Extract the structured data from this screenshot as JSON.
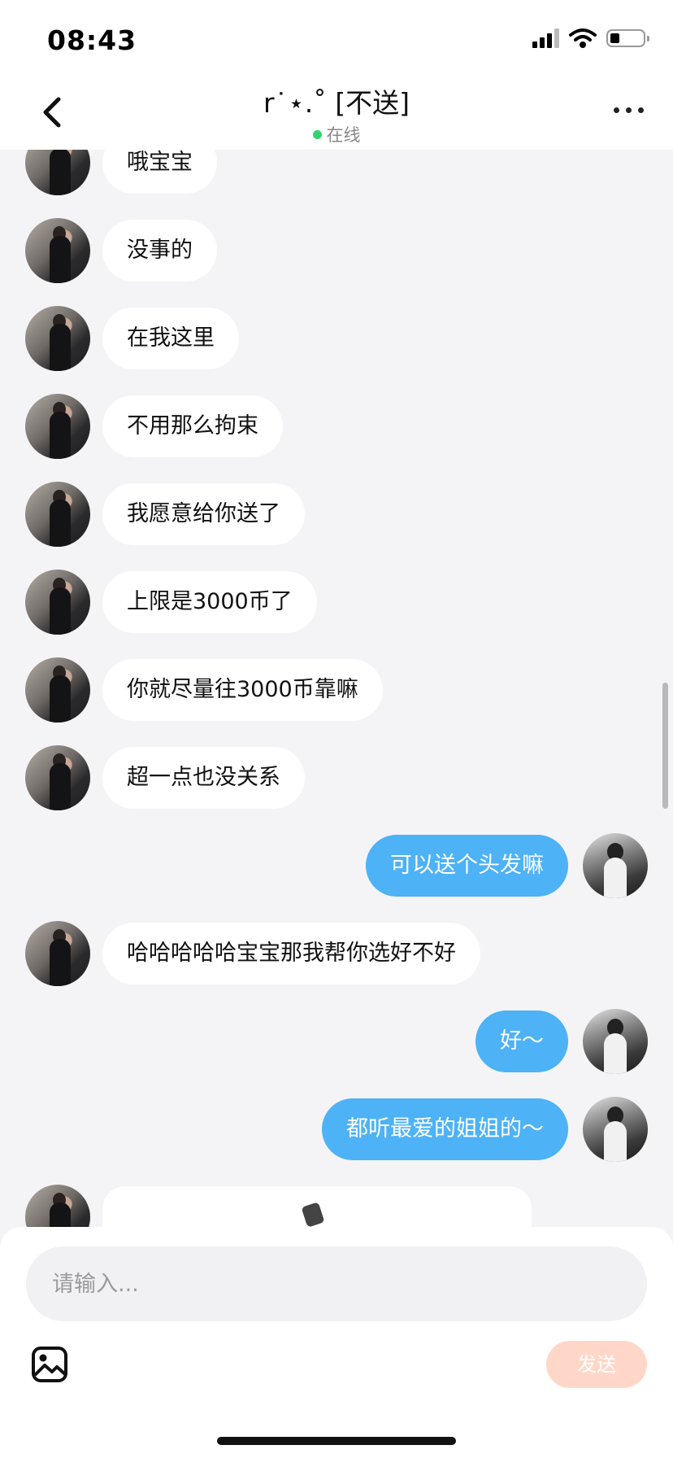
{
  "status_bar": {
    "time": "08:43",
    "icons": [
      "signal-icon",
      "wifi-icon",
      "battery-icon"
    ]
  },
  "nav": {
    "back_icon": "chevron-left-icon",
    "title": "r˙⋆.˚ [不送]",
    "status": "在线",
    "status_color": "#33d36e",
    "more_icon": "more-horizontal-icon"
  },
  "messages": [
    {
      "sender": "other",
      "text": "哦宝宝"
    },
    {
      "sender": "other",
      "text": "没事的"
    },
    {
      "sender": "other",
      "text": "在我这里"
    },
    {
      "sender": "other",
      "text": "不用那么拘束"
    },
    {
      "sender": "other",
      "text": "我愿意给你送了"
    },
    {
      "sender": "other",
      "text": "上限是3000币了"
    },
    {
      "sender": "other",
      "text": "你就尽量往3000币靠嘛"
    },
    {
      "sender": "other",
      "text": "超一点也没关系"
    },
    {
      "sender": "self",
      "text": "可以送个头发嘛"
    },
    {
      "sender": "other",
      "text": "哈哈哈哈哈宝宝那我帮你选好不好"
    },
    {
      "sender": "self",
      "text": "好～"
    },
    {
      "sender": "self",
      "text": "都听最爱的姐姐的～"
    },
    {
      "sender": "other",
      "type": "card",
      "text": ""
    }
  ],
  "composer": {
    "placeholder": "请输入...",
    "image_icon": "image-icon",
    "send_label": "发送"
  },
  "colors": {
    "self_bubble": "#4db2f6",
    "other_bubble": "#ffffff",
    "background": "#f4f4f6",
    "send_button_disabled": "#ffd7c8"
  }
}
